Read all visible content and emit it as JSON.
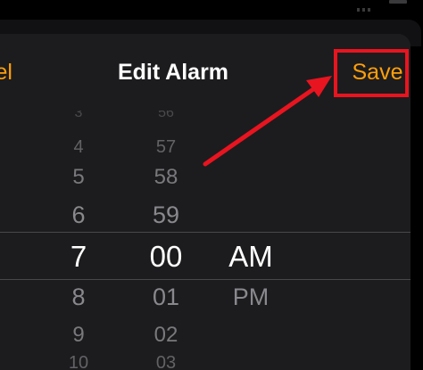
{
  "nav": {
    "cancel_label": "el",
    "title": "Edit Alarm",
    "save_label": "Save"
  },
  "picker": {
    "hours": [
      "3",
      "4",
      "5",
      "6",
      "7",
      "8",
      "9",
      "10"
    ],
    "minutes": [
      "56",
      "57",
      "58",
      "59",
      "00",
      "01",
      "02",
      "03"
    ],
    "periods": [
      "AM",
      "PM"
    ],
    "selected": {
      "hour": "7",
      "minute": "00",
      "period": "AM"
    }
  },
  "colors": {
    "accent": "#ff9f0a",
    "annotation": "#e8141f",
    "sheet_background": "#1c1c1e",
    "selected_text": "#ffffff",
    "unselected_text": "#8e8e93"
  },
  "icons": {
    "annotation_arrow": "red-arrow-icon"
  }
}
